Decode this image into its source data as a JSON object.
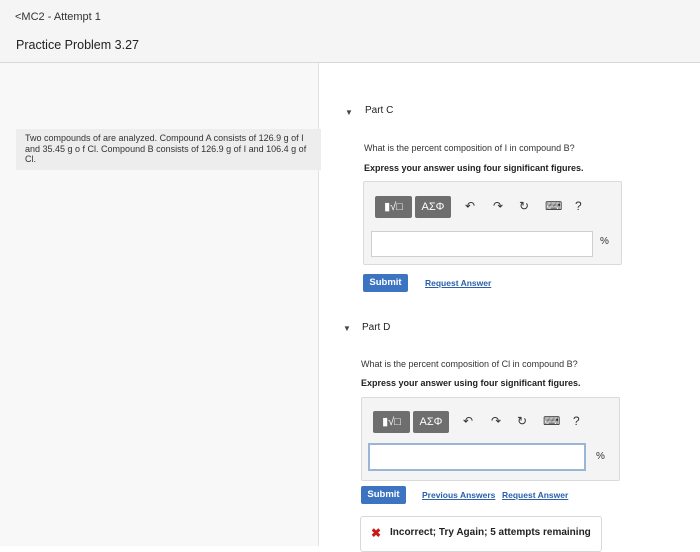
{
  "header": {
    "back_label": "<MC2 - Attempt 1",
    "problem_title": "Practice Problem 3.27"
  },
  "problem": {
    "text": "Two compounds of are analyzed. Compound A consists of 126.9 g of I and 35.45 g o f Cl. Compound B consists of 126.9 g of I and 106.4 g of Cl."
  },
  "part_c": {
    "toggle_icon": "triangle-down",
    "label": "Part C",
    "question": "What is the percent composition of I in compound B?",
    "instruction": "Express your answer using four significant figures.",
    "toolbar": {
      "template_btn": "▮√□",
      "greek_btn": "AΣΦ",
      "undo_icon": "↶",
      "redo_icon": "↷",
      "reset_icon": "↻",
      "keyboard_icon": "⌨",
      "help_icon": "?"
    },
    "input_value": "",
    "unit": "%",
    "submit_label": "Submit",
    "request_answer_label": "Request Answer"
  },
  "part_d": {
    "toggle_icon": "triangle-down",
    "label": "Part D",
    "question": "What is the percent composition of Cl in compound B?",
    "instruction": "Express your answer using four significant figures.",
    "toolbar": {
      "template_btn": "▮√□",
      "greek_btn": "AΣΦ",
      "undo_icon": "↶",
      "redo_icon": "↷",
      "reset_icon": "↻",
      "keyboard_icon": "⌨",
      "help_icon": "?"
    },
    "input_value": "",
    "unit": "%",
    "submit_label": "Submit",
    "previous_answers_label": "Previous Answers",
    "request_answer_label": "Request Answer",
    "feedback": "Incorrect; Try Again; 5 attempts remaining"
  },
  "colors": {
    "submit": "#3d74c2",
    "link": "#2a5faa",
    "error": "#c61b1b"
  }
}
